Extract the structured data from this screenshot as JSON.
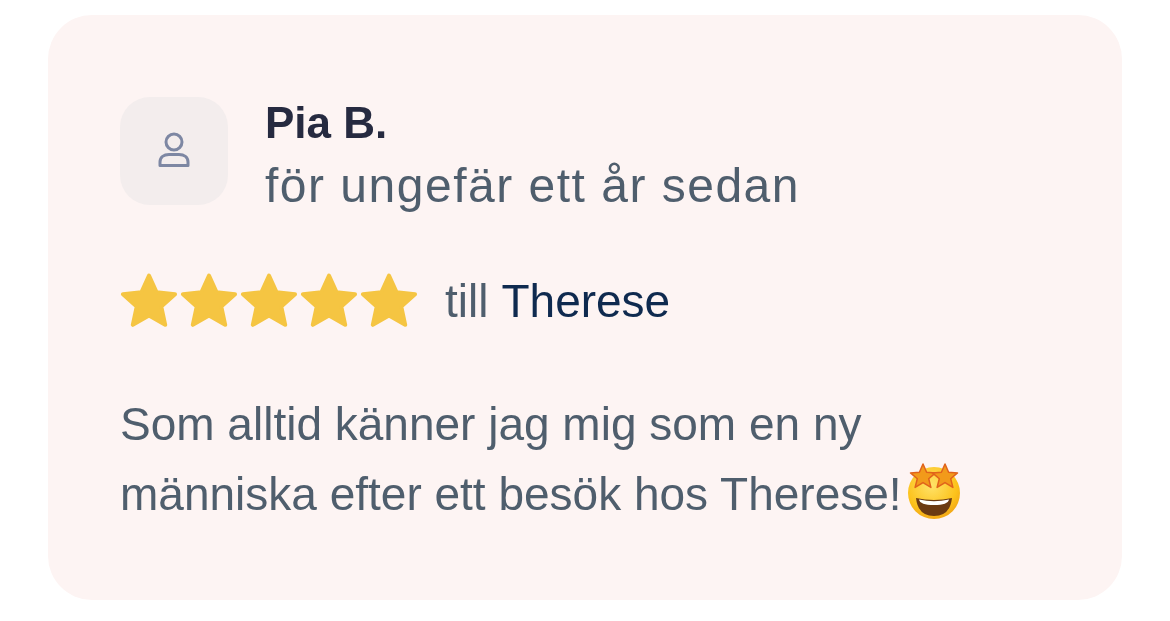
{
  "review": {
    "author": "Pia B.",
    "time": "för ungefär ett år sedan",
    "stars": 5,
    "recipient_prefix": "till",
    "recipient": "Therese",
    "text": "Som alltid känner jag mig som en ny människa efter ett besök hos Therese!"
  }
}
